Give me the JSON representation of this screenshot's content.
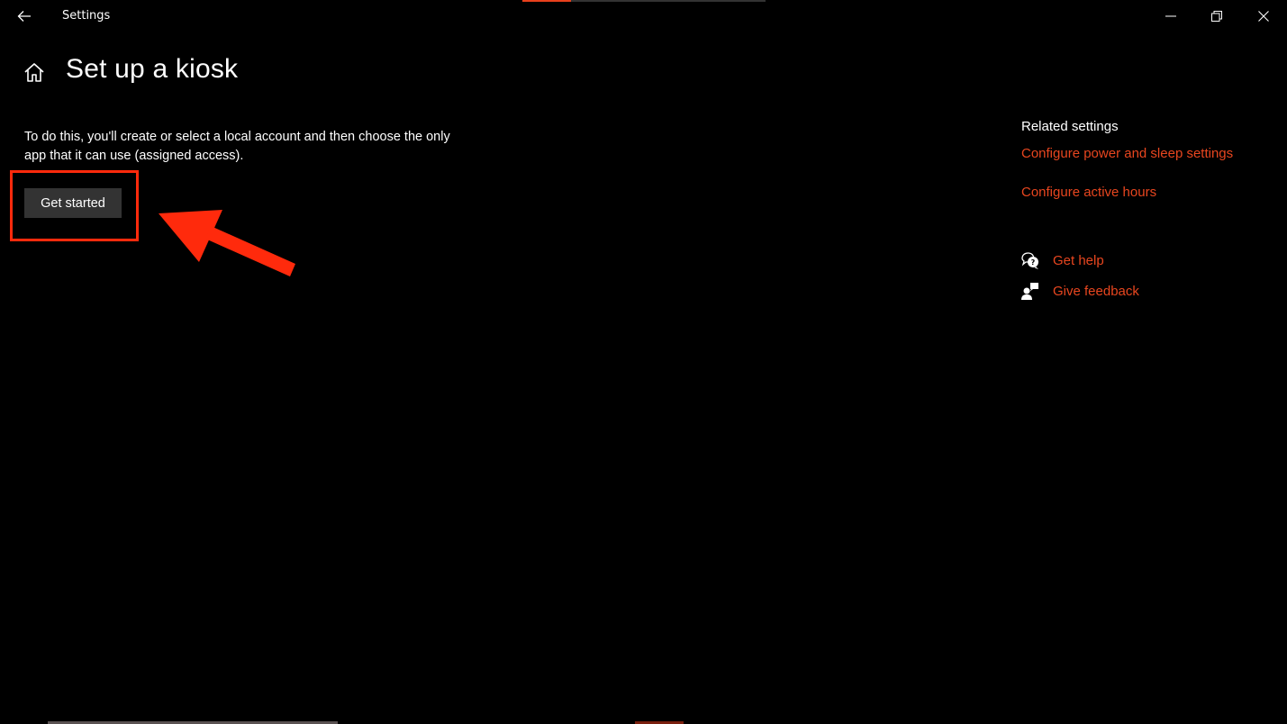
{
  "window": {
    "title": "Settings",
    "controls": {
      "minimize": "minimize-icon",
      "restore": "restore-icon",
      "close": "close-icon"
    },
    "progress": 0.2
  },
  "header": {
    "home_icon": "home-icon",
    "title": "Set up a kiosk"
  },
  "main": {
    "description": "To do this, you'll create or select a local account and then choose the only app that it can use (assigned access).",
    "get_started_label": "Get started"
  },
  "related": {
    "title": "Related settings",
    "links": [
      {
        "label": "Configure power and sleep settings"
      },
      {
        "label": "Configure active hours"
      }
    ]
  },
  "support": {
    "items": [
      {
        "icon": "get-help-icon",
        "label": "Get help"
      },
      {
        "icon": "give-feedback-icon",
        "label": "Give feedback"
      }
    ]
  },
  "colors": {
    "accent": "#e8461f",
    "annotation": "#ff2a0c",
    "button_bg": "#333333",
    "background": "#000000"
  }
}
